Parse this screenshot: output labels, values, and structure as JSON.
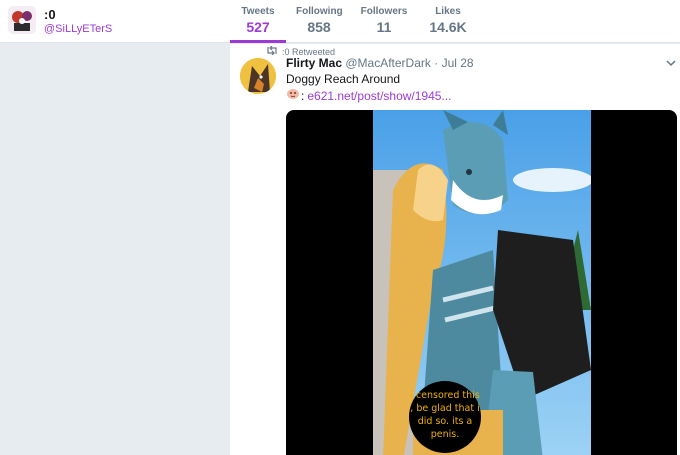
{
  "profile": {
    "name": ":0",
    "handle": "@SiLLyETerS"
  },
  "stats": [
    {
      "label": "Tweets",
      "value": "527",
      "active": true
    },
    {
      "label": "Following",
      "value": "858",
      "active": false
    },
    {
      "label": "Followers",
      "value": "11",
      "active": false
    },
    {
      "label": "Likes",
      "value": "14.6K",
      "active": false
    }
  ],
  "tweet": {
    "retweet_text": ":0 Retweeted",
    "author": "Flirty Mac",
    "handle": "@MacAfterDark",
    "separator": "·",
    "date": "Jul 28",
    "text": "Doggy Reach Around",
    "link_colon": ":",
    "link": "e621.net/post/show/1945...",
    "censor_text": "i censored this , be glad that i did so. its a penis."
  },
  "colors": {
    "accent": "#9b3bd4",
    "muted": "#657786",
    "background": "#e6ecf0"
  },
  "icons": {
    "retweet": "retweet-icon",
    "caret": "chevron-down-icon",
    "emoji": "face-emoji-icon"
  }
}
